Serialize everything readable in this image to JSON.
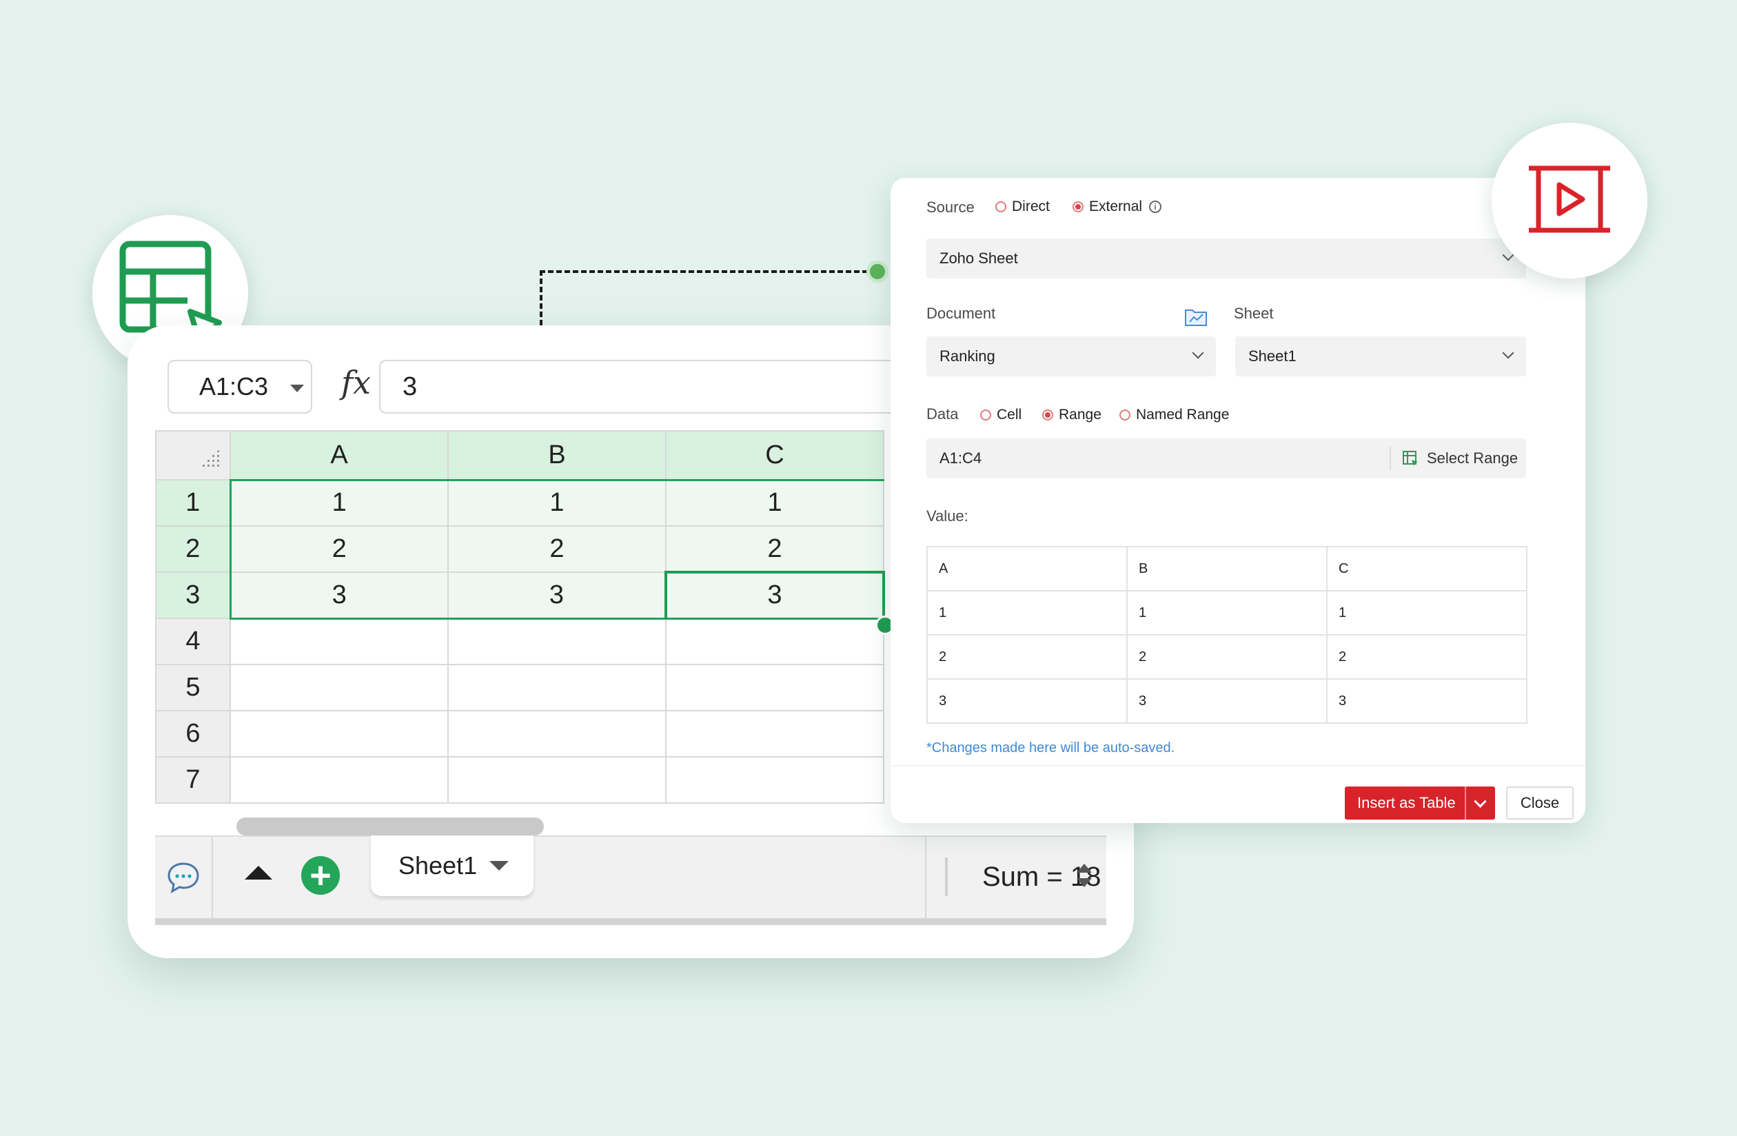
{
  "spreadsheet": {
    "name_box": "A1:C3",
    "fx_symbol": "fx",
    "formula_value": "3",
    "columns": [
      "A",
      "B",
      "C"
    ],
    "rows": [
      {
        "label": "1",
        "cells": [
          "1",
          "1",
          "1"
        ]
      },
      {
        "label": "2",
        "cells": [
          "2",
          "2",
          "2"
        ]
      },
      {
        "label": "3",
        "cells": [
          "3",
          "3",
          "3"
        ]
      },
      {
        "label": "4",
        "cells": [
          "",
          "",
          ""
        ]
      },
      {
        "label": "5",
        "cells": [
          "",
          "",
          ""
        ]
      },
      {
        "label": "6",
        "cells": [
          "",
          "",
          ""
        ]
      },
      {
        "label": "7",
        "cells": [
          "",
          "",
          ""
        ]
      }
    ],
    "sheet_tab": "Sheet1",
    "sum_status": "Sum = 18",
    "icons": {
      "chat": "chat-bubble-icon",
      "up": "triangle-up-icon",
      "add": "plus-circle-icon",
      "table_badge": "table-cursor-icon"
    },
    "accent": "#1f9c52"
  },
  "dialog": {
    "source_label": "Source",
    "source_options": [
      {
        "label": "Direct",
        "selected": false
      },
      {
        "label": "External",
        "selected": true
      }
    ],
    "info_icon": "info-icon",
    "source_app": "Zoho Sheet",
    "document_label": "Document",
    "document_value": "Ranking",
    "sheet_label": "Sheet",
    "sheet_value": "Sheet1",
    "data_label": "Data",
    "data_options": [
      {
        "label": "Cell",
        "selected": false
      },
      {
        "label": "Range",
        "selected": true
      },
      {
        "label": "Named Range",
        "selected": false
      }
    ],
    "range_value": "A1:C4",
    "select_range_label": "Select Range",
    "value_label": "Value:",
    "value_table": [
      [
        "A",
        "B",
        "C"
      ],
      [
        "1",
        "1",
        "1"
      ],
      [
        "2",
        "2",
        "2"
      ],
      [
        "3",
        "3",
        "3"
      ]
    ],
    "autosave_note": "*Changes made here will be auto-saved.",
    "insert_button": "Insert as Table",
    "close_button": "Close",
    "embed_badge": "embed-media-icon",
    "accent": "#d8232a"
  }
}
